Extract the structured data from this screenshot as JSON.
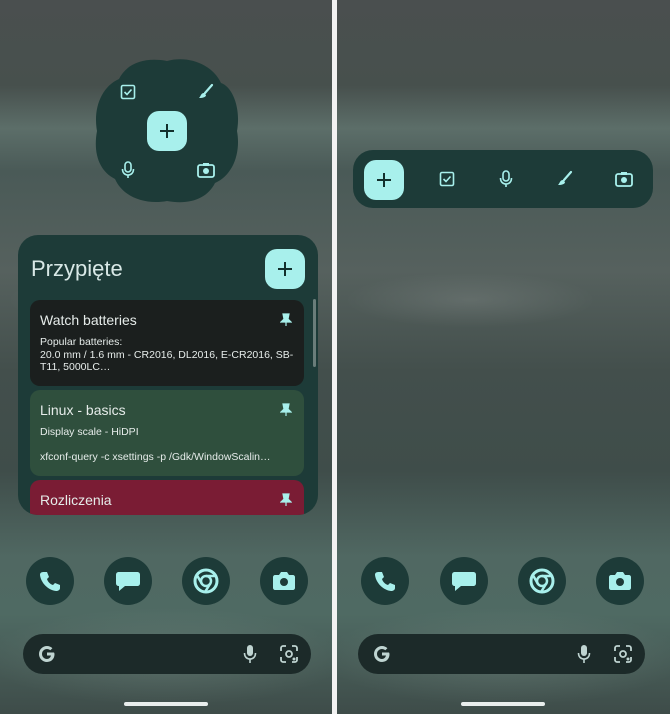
{
  "pinned": {
    "title": "Przypięte",
    "notes": [
      {
        "title": "Watch batteries",
        "body": "Popular batteries:\n20.0 mm / 1.6 mm - CR2016, DL2016, E-CR2016, SB-T11, 5000LC…",
        "color": "#1b1f1e"
      },
      {
        "title": "Linux - basics",
        "body": "Display scale - HiDPI\n\nxfconf-query -c xsettings -p /Gdk/WindowScalin…",
        "color": "#2f4f3d"
      },
      {
        "title": "Rozliczenia",
        "body": "",
        "color": "#7a1c34"
      }
    ]
  },
  "quick_actions": [
    "checkbox-icon",
    "brush-icon",
    "mic-icon",
    "camera-icon"
  ],
  "dock": [
    "phone-icon",
    "messages-icon",
    "chrome-icon",
    "camera-icon"
  ],
  "colors": {
    "accent": "#a8f0ec",
    "widget_bg": "#1d3b38",
    "icon": "#a8f0ec"
  }
}
